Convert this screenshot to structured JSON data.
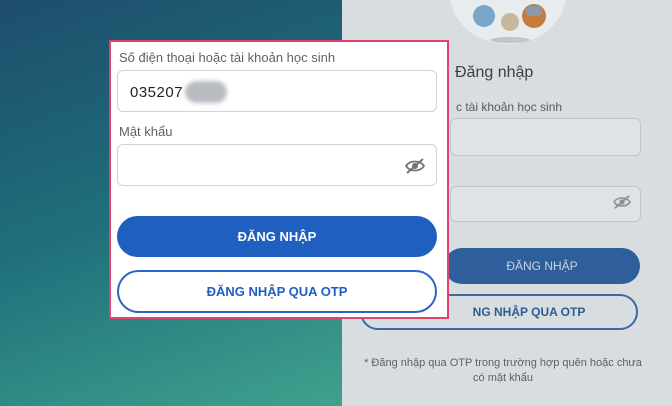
{
  "background": {
    "title": "Đăng nhập",
    "username_label_partial": "c tài khoản học sinh",
    "login_button": "ĐĂNG NHẬP",
    "otp_button_partial": "NG NHẬP QUA OTP",
    "note": "* Đăng nhập qua OTP trong trường hợp quên hoặc chưa có mật khẩu"
  },
  "form": {
    "username_label": "Số điện thoại hoặc tài khoản học sinh",
    "username_value": "035207",
    "password_label": "Mật khẩu",
    "login_button": "ĐĂNG NHẬP",
    "otp_button": "ĐĂNG NHẬP QUA OTP"
  },
  "icons": {
    "password_visibility": "eye-slash-icon"
  },
  "colors": {
    "primary": "#1f5fbf",
    "highlight_border": "#e0436f"
  }
}
